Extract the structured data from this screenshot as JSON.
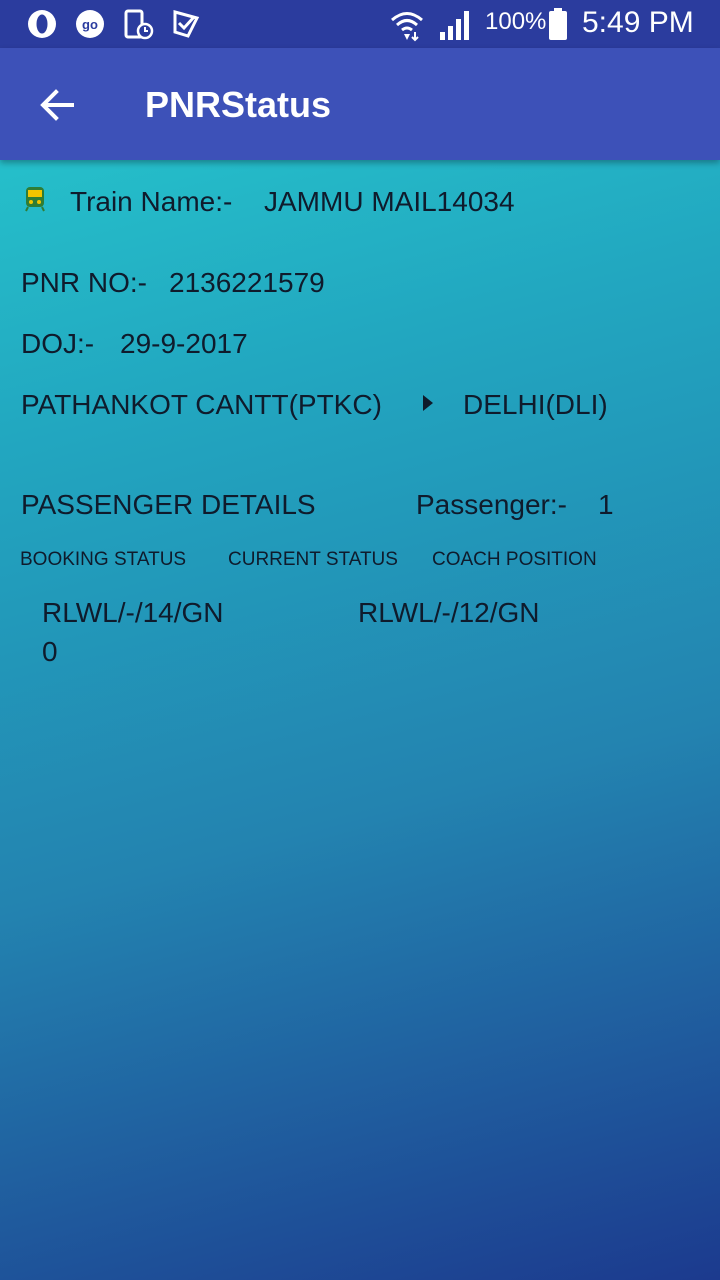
{
  "status_bar": {
    "battery_percent": "100%",
    "time": "5:49 PM",
    "icons": [
      "opera-icon",
      "goibibo-icon",
      "phone-clock-icon",
      "checkmark-app-icon",
      "wifi-icon",
      "signal-icon",
      "battery-icon"
    ]
  },
  "app_bar": {
    "title": "PNRStatus",
    "back_icon": "arrow-left-icon"
  },
  "train": {
    "label": "Train Name:-",
    "value": "JAMMU MAIL14034",
    "icon": "train-icon"
  },
  "pnr": {
    "label": "PNR NO:-",
    "value": "2136221579"
  },
  "doj": {
    "label": "DOJ:-",
    "value": "29-9-2017"
  },
  "route": {
    "from": "PATHANKOT CANTT(PTKC)",
    "to": "DELHI(DLI)",
    "icon": "play-arrow-icon"
  },
  "passenger_section": {
    "title": "PASSENGER DETAILS",
    "count_label": "Passenger:-",
    "count_value": "1"
  },
  "columns": {
    "booking_status": "BOOKING STATUS",
    "current_status": "CURRENT STATUS",
    "coach_position": "COACH POSITION"
  },
  "passengers": [
    {
      "booking_status_line1": "RLWL/-/14/GN",
      "booking_status_line2": "0",
      "current_status": "RLWL/-/12/GN",
      "coach_position": ""
    }
  ],
  "colors": {
    "status_bar": "#2b3c9e",
    "app_bar": "#3d51b8",
    "gradient_top": "#27cdd0",
    "gradient_bottom": "#1c3a8e"
  }
}
